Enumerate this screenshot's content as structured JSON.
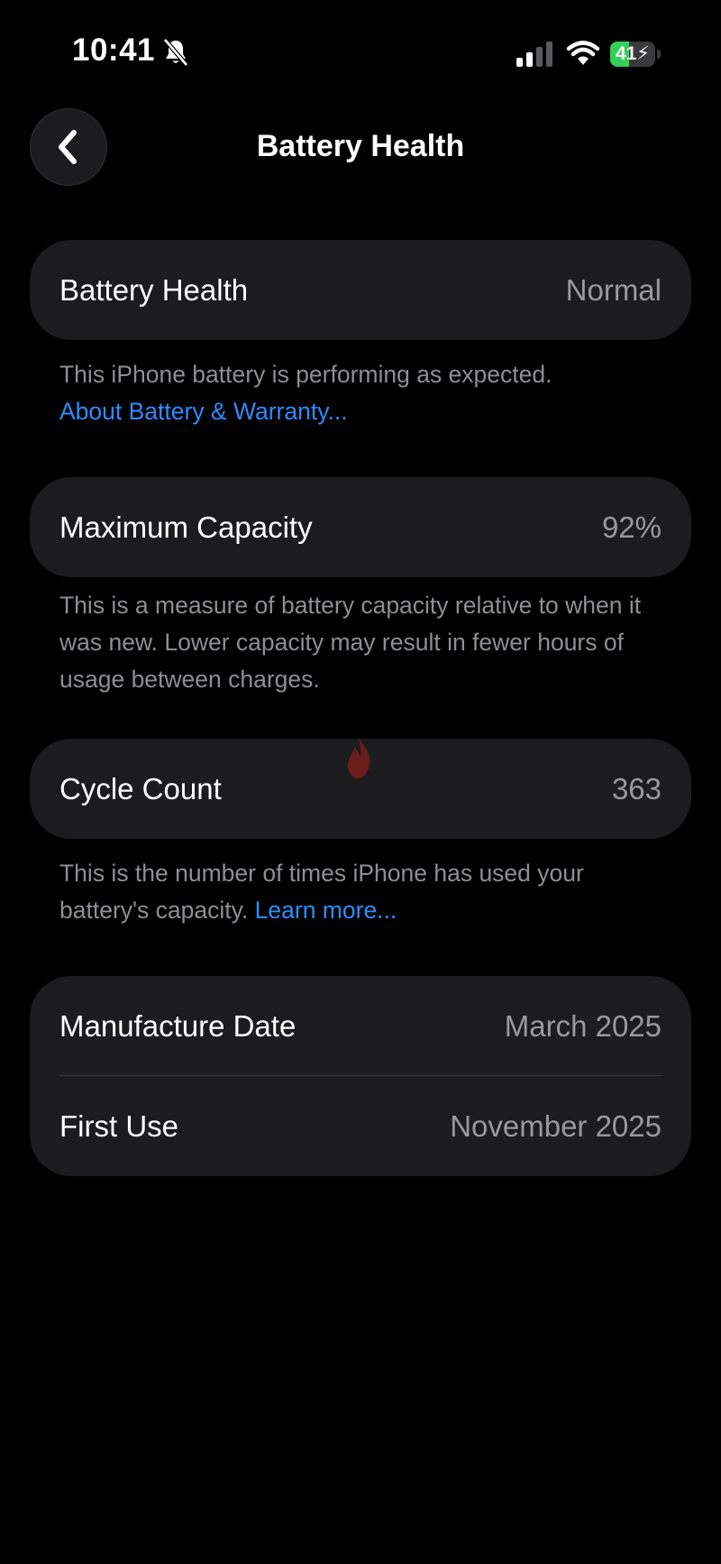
{
  "status_bar": {
    "time": "10:41",
    "battery_level": "41",
    "battery_fraction": 0.41,
    "colors": {
      "battery_green": "#30d158"
    },
    "icons": [
      "bell-slash-icon",
      "cellular-signal-icon",
      "wifi-icon",
      "battery-charging-icon"
    ]
  },
  "nav": {
    "title": "Battery Health",
    "back_icon": "chevron-left-icon"
  },
  "sections": {
    "health": {
      "label": "Battery Health",
      "value": "Normal",
      "footnote": "This iPhone battery is performing as expected.",
      "link": "About Battery & Warranty..."
    },
    "capacity": {
      "label": "Maximum Capacity",
      "value": "92%",
      "footnote": "This is a measure of battery capacity relative to when it was new. Lower capacity may result in fewer hours of usage between charges."
    },
    "cycles": {
      "label": "Cycle Count",
      "value": "363",
      "footnote": "This is the number of times iPhone has used your battery's capacity.",
      "link": "Learn more..."
    },
    "dates": {
      "manufacture_label": "Manufacture Date",
      "manufacture_value": "March 2025",
      "first_use_label": "First Use",
      "first_use_value": "November 2025"
    }
  },
  "colors": {
    "background": "#000000",
    "card": "#1c1c1e",
    "secondary_text": "#8e8e93",
    "link": "#2d8cff"
  }
}
